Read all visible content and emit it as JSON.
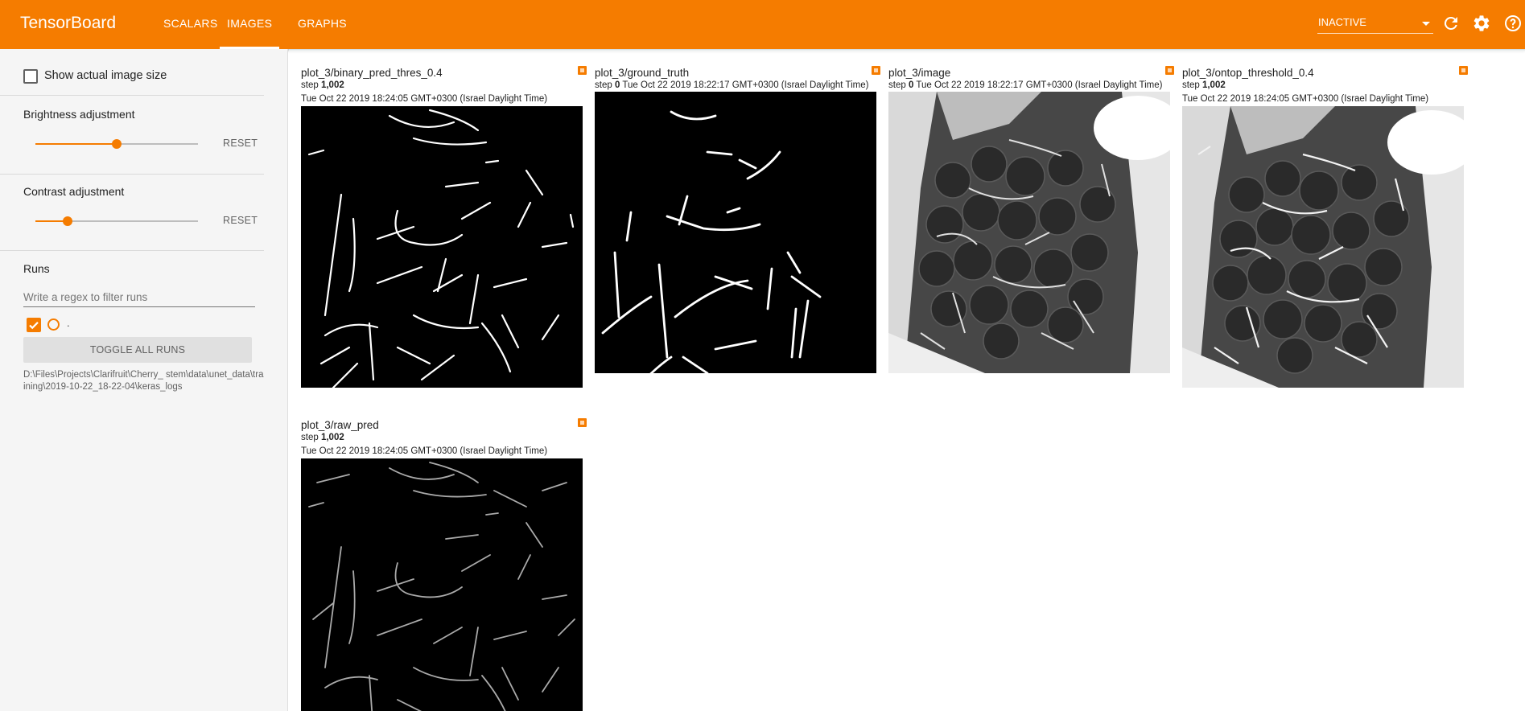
{
  "app": {
    "brand": "TensorBoard",
    "tabs": [
      {
        "label": "SCALARS",
        "active": false
      },
      {
        "label": "IMAGES",
        "active": true
      },
      {
        "label": "GRAPHS",
        "active": false
      }
    ],
    "status_select": "INACTIVE",
    "accent_color": "#f57c00"
  },
  "sidebar": {
    "show_actual_size_label": "Show actual image size",
    "brightness": {
      "label": "Brightness adjustment",
      "value": 0.5,
      "reset_label": "RESET"
    },
    "contrast": {
      "label": "Contrast adjustment",
      "value": 0.2,
      "reset_label": "RESET"
    },
    "runs": {
      "title": "Runs",
      "filter_placeholder": "Write a regex to filter runs",
      "run_name": ".",
      "toggle_label": "TOGGLE ALL RUNS",
      "path": "D:\\Files\\Projects\\Clarifruit\\Cherry_ stem\\data\\unet_data\\training\\2019-10-22_18-22-04\\keras_logs"
    }
  },
  "cards": [
    {
      "title": "plot_3/binary_pred_thres_0.4",
      "step_label": "step",
      "step": "1,002",
      "time": "Tue Oct 22 2019 18:24:05 GMT+0300 (Israel Daylight Time)",
      "image_icon": "binary-mask-image"
    },
    {
      "title": "plot_3/ground_truth",
      "step_label": "step",
      "step": "0",
      "time": "Tue Oct 22 2019 18:22:17 GMT+0300 (Israel Daylight Time)",
      "image_icon": "ground-truth-mask-image"
    },
    {
      "title": "plot_3/image",
      "step_label": "step",
      "step": "0",
      "time": "Tue Oct 22 2019 18:22:17 GMT+0300 (Israel Daylight Time)",
      "image_icon": "cherries-photo"
    },
    {
      "title": "plot_3/ontop_threshold_0.4",
      "step_label": "step",
      "step": "1,002",
      "time": "Tue Oct 22 2019 18:24:05 GMT+0300 (Israel Daylight Time)",
      "image_icon": "cherries-overlay-photo"
    },
    {
      "title": "plot_3/raw_pred",
      "step_label": "step",
      "step": "1,002",
      "time": "Tue Oct 22 2019 18:24:05 GMT+0300 (Israel Daylight Time)",
      "image_icon": "raw-prediction-image"
    }
  ]
}
